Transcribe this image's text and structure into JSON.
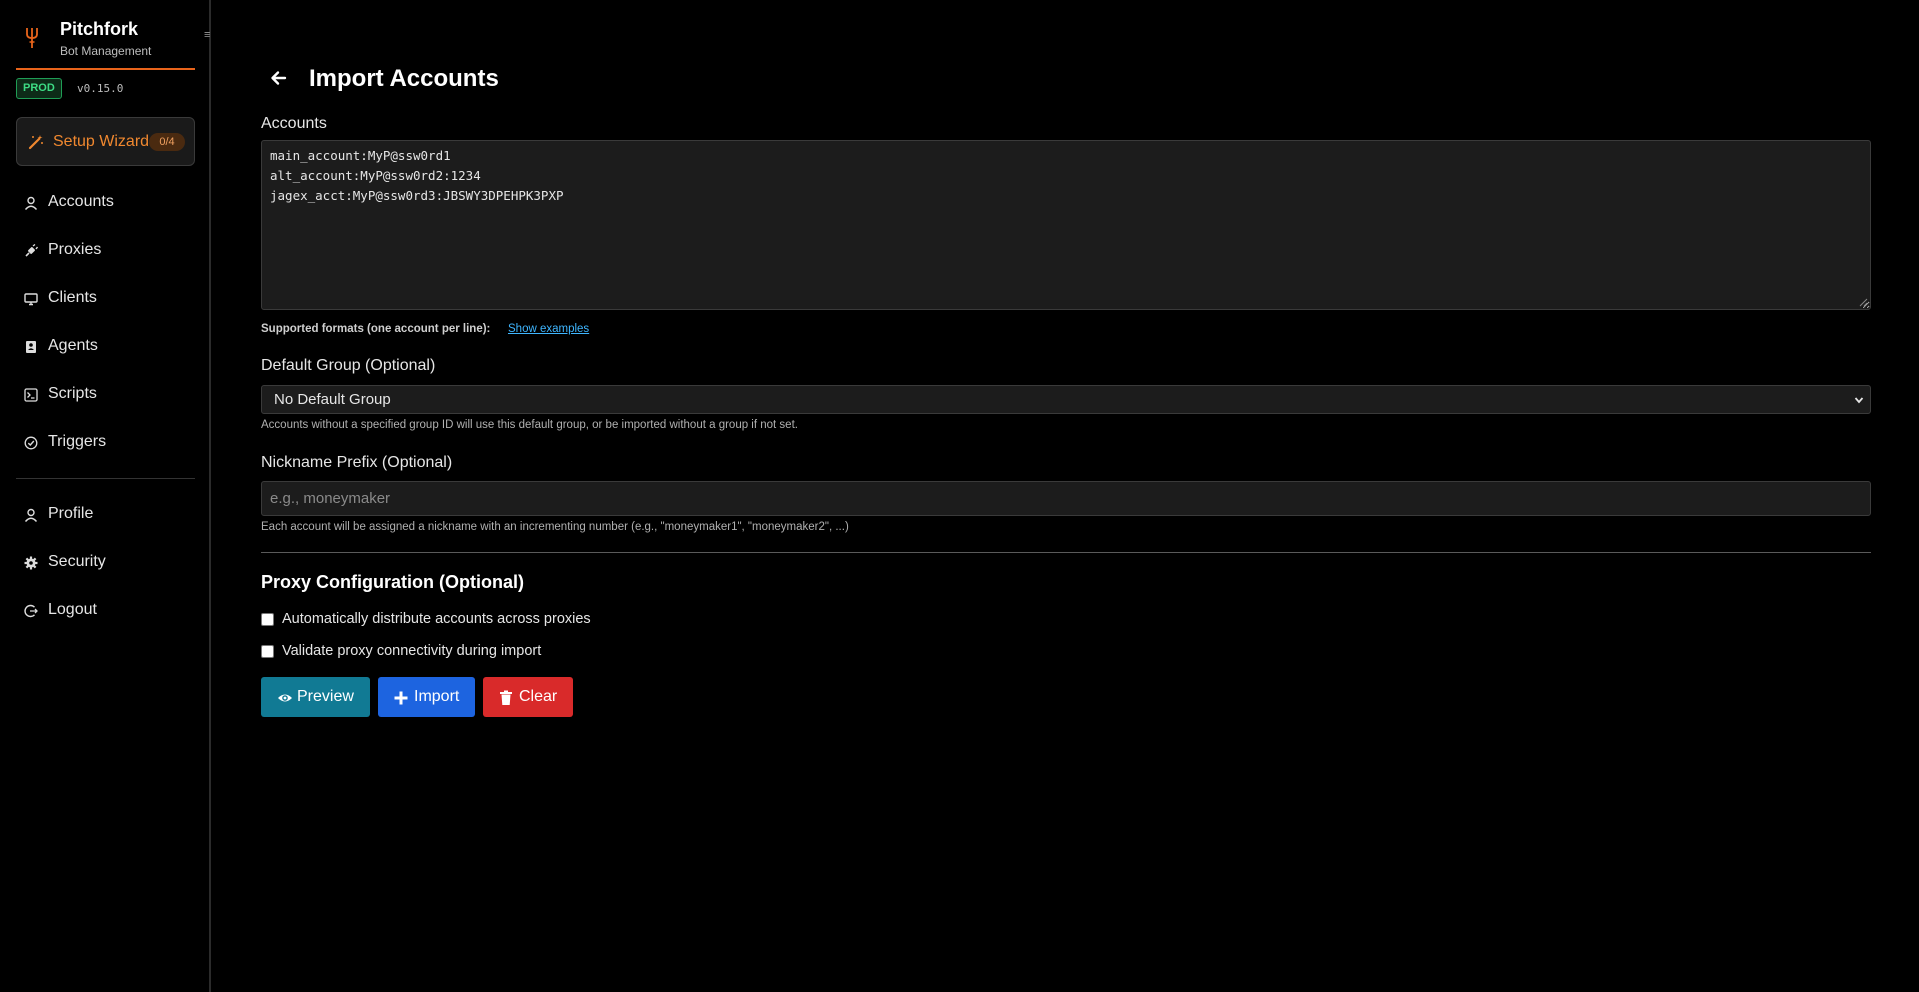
{
  "sidebar": {
    "brand_title": "Pitchfork",
    "brand_subtitle": "Bot Management",
    "env_badge": "PROD",
    "version": "v0.15.0",
    "wizard": {
      "label": "Setup Wizard",
      "count": "0/4"
    },
    "nav_main": [
      {
        "label": "Accounts",
        "icon": "user-icon"
      },
      {
        "label": "Proxies",
        "icon": "plug-icon"
      },
      {
        "label": "Clients",
        "icon": "monitor-icon"
      },
      {
        "label": "Agents",
        "icon": "agent-icon"
      },
      {
        "label": "Scripts",
        "icon": "terminal-icon"
      },
      {
        "label": "Triggers",
        "icon": "check-circle-icon"
      }
    ],
    "nav_user": [
      {
        "label": "Profile",
        "icon": "user-icon"
      },
      {
        "label": "Security",
        "icon": "gear-icon"
      },
      {
        "label": "Logout",
        "icon": "logout-icon"
      }
    ]
  },
  "main": {
    "page_title": "Import Accounts",
    "accounts": {
      "label": "Accounts",
      "value": "main_account:MyP@ssw0rd1\nalt_account:MyP@ssw0rd2:1234\njagex_acct:MyP@ssw0rd3:JBSWY3DPEHPK3PXP",
      "hint": "Supported formats (one account per line):",
      "hint_link": "Show examples"
    },
    "default_group": {
      "label": "Default Group (Optional)",
      "selected": "No Default Group",
      "help": "Accounts without a specified group ID will use this default group, or be imported without a group if not set."
    },
    "nickname_prefix": {
      "label": "Nickname Prefix (Optional)",
      "placeholder": "e.g., moneymaker",
      "help": "Each account will be assigned a nickname with an incrementing number (e.g., \"moneymaker1\", \"moneymaker2\", ...)"
    },
    "proxy": {
      "title": "Proxy Configuration (Optional)",
      "distribute_label": "Automatically distribute accounts across proxies",
      "validate_label": "Validate proxy connectivity during import"
    },
    "buttons": {
      "preview": "Preview",
      "import": "Import",
      "clear": "Clear"
    },
    "colors": {
      "accent": "#f0882f",
      "preview": "#117a94",
      "import": "#1d64e0",
      "clear": "#d92a2a",
      "prod_badge": "#3ddc84"
    }
  }
}
